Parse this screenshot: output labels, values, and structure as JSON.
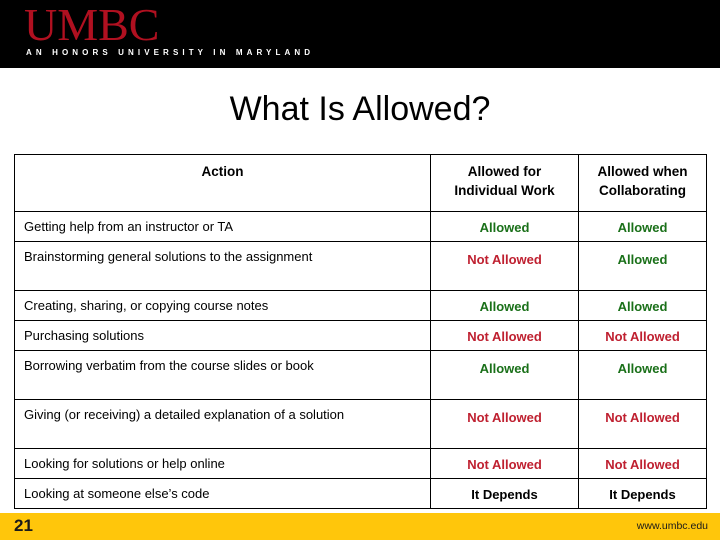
{
  "header": {
    "wordmark": "UMBC",
    "tagline": "AN HONORS UNIVERSITY IN MARYLAND",
    "background_color": "#000000",
    "wordmark_color": "#b01020"
  },
  "slide": {
    "title": "What Is Allowed?"
  },
  "table": {
    "columns": [
      {
        "key": "action",
        "label": "Action"
      },
      {
        "key": "individual",
        "label_line1": "Allowed for",
        "label_line2": "Individual Work"
      },
      {
        "key": "collaborating",
        "label_line1": "Allowed when",
        "label_line2": "Collaborating"
      }
    ],
    "rows": [
      {
        "action": "Getting help from an instructor or TA",
        "individual": "Allowed",
        "collaborating": "Allowed"
      },
      {
        "action": "Brainstorming general solutions to the assignment",
        "individual": "Not Allowed",
        "collaborating": "Allowed"
      },
      {
        "action": "Creating, sharing, or copying course notes",
        "individual": "Allowed",
        "collaborating": "Allowed"
      },
      {
        "action": "Purchasing solutions",
        "individual": "Not Allowed",
        "collaborating": "Not Allowed"
      },
      {
        "action": "Borrowing verbatim from the course slides or book",
        "individual": "Allowed",
        "collaborating": "Allowed"
      },
      {
        "action": "Giving (or receiving) a detailed explanation of a solution",
        "individual": "Not Allowed",
        "collaborating": "Not Allowed"
      },
      {
        "action": "Looking for solutions or help online",
        "individual": "Not Allowed",
        "collaborating": "Not Allowed"
      },
      {
        "action": "Looking at someone else’s code",
        "individual": "It Depends",
        "collaborating": "It Depends"
      }
    ],
    "status_colors": {
      "Allowed": "#1a7019",
      "Not Allowed": "#bf2030",
      "It Depends": "#000000"
    }
  },
  "footer": {
    "slide_number": "21",
    "url": "www.umbc.edu",
    "background_color": "#ffc60b"
  }
}
